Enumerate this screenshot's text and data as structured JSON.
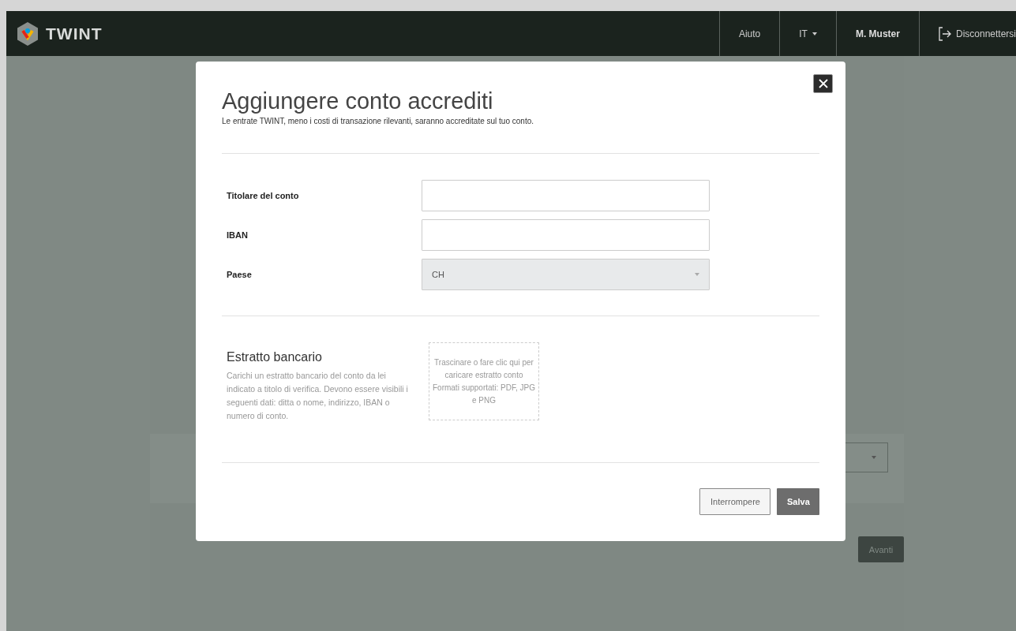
{
  "header": {
    "logo": "TWINT",
    "nav": [
      {
        "label": "Aiuto",
        "kind": "link"
      },
      {
        "label": "IT",
        "kind": "dropdown"
      }
    ],
    "user": "M. Muster",
    "logout": "Disconnettersi"
  },
  "background": {
    "button": "Avanti"
  },
  "dialog": {
    "title": "Aggiungere conto accrediti",
    "subtitle": "Le entrate TWINT, meno i costi di transazione rilevanti, saranno accreditate sul tuo conto.",
    "fields": [
      {
        "label": "Titolare del conto",
        "kind": "text"
      },
      {
        "label": "IBAN",
        "kind": "text"
      },
      {
        "label": "Paese",
        "kind": "select",
        "value": "CH"
      }
    ],
    "statement": {
      "title": "Estratto bancario",
      "description": "Carichi un estratto bancario del conto da lei indicato a titolo di verifica. Devono essere visibili i seguenti dati: ditta o nome, indirizzo, IBAN o numero di conto.",
      "dropzone": [
        "Trascinare o fare clic qui per caricare estratto conto",
        "Formati supportati: PDF, JPG e PNG"
      ]
    },
    "buttons": [
      {
        "label": "Interrompere",
        "kind": "secondary"
      },
      {
        "label": "Salva",
        "kind": "primary"
      }
    ]
  }
}
